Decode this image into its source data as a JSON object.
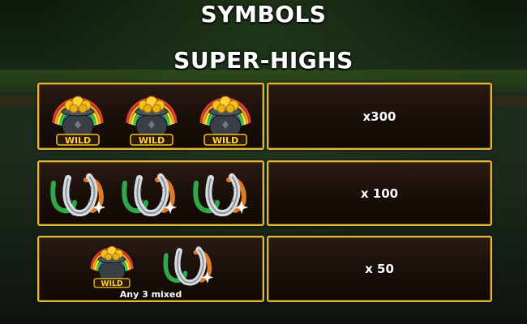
{
  "header": {
    "title": "SYMBOLS",
    "subtitle": "SUPER-HIGHS"
  },
  "symbol_icons": {
    "wild": "pot-of-gold-wild-icon",
    "horseshoe": "horseshoes-icon"
  },
  "wild_label": "WILD",
  "rows": [
    {
      "symbols": [
        "wild",
        "wild",
        "wild"
      ],
      "payout": "x300"
    },
    {
      "symbols": [
        "horseshoe",
        "horseshoe",
        "horseshoe"
      ],
      "payout": "x 100"
    },
    {
      "symbols": [
        "wild",
        "horseshoe"
      ],
      "payout": "x 50",
      "caption": "Any 3 mixed"
    }
  ],
  "colors": {
    "border_gold": "#e0b83a",
    "text": "#ffffff",
    "panel_dark": "#1a0f0a"
  }
}
